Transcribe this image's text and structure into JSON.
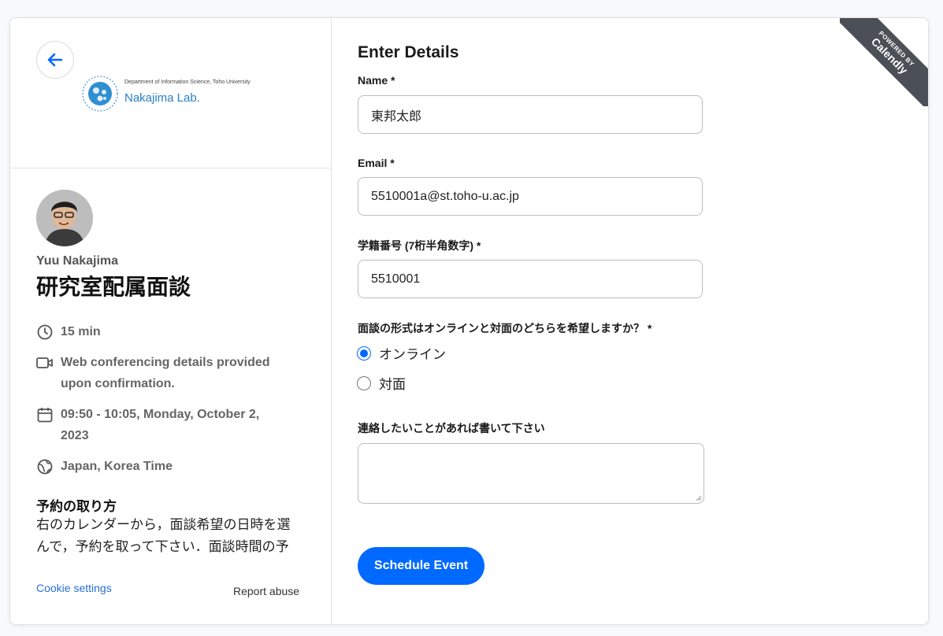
{
  "brand": {
    "department": "Department of Information Science, Toho University",
    "lab": "Nakajima Lab."
  },
  "host": {
    "name": "Yuu Nakajima"
  },
  "event": {
    "title": "研究室配属面談",
    "duration": "15 min",
    "conferencing_line1": "Web conferencing details provided",
    "conferencing_line2": "upon confirmation.",
    "datetime_line1": "09:50 - 10:05, Monday, October 2,",
    "datetime_line2": "2023",
    "timezone": "Japan, Korea Time"
  },
  "howto": {
    "title": "予約の取り方",
    "line1": "右のカレンダーから，面談希望の日時を選",
    "line2": "んで，予約を取って下さい．面談時間の予"
  },
  "footer": {
    "cookie": "Cookie settings",
    "report": "Report abuse"
  },
  "form": {
    "title": "Enter Details",
    "name_label": "Name *",
    "name_value": "東邦太郎",
    "email_label": "Email *",
    "email_value": "5510001a@st.toho-u.ac.jp",
    "student_id_label": "学籍番号 (7桁半角数字) *",
    "student_id_value": "5510001",
    "format_label": "面談の形式はオンラインと対面のどちらを希望しますか？ *",
    "format_options": [
      "オンライン",
      "対面"
    ],
    "format_selected": "オンライン",
    "notes_label": "連絡したいことがあれば書いて下さい",
    "notes_value": "",
    "submit_label": "Schedule Event"
  },
  "ribbon": {
    "powered": "POWERED BY",
    "name": "Calendly"
  },
  "colors": {
    "accent": "#0069ff",
    "lab_blue": "#2a7fc6",
    "ribbon": "#4b4f56"
  },
  "icons": [
    "back-arrow-icon",
    "clock-icon",
    "video-camera-icon",
    "calendar-icon",
    "globe-icon"
  ]
}
